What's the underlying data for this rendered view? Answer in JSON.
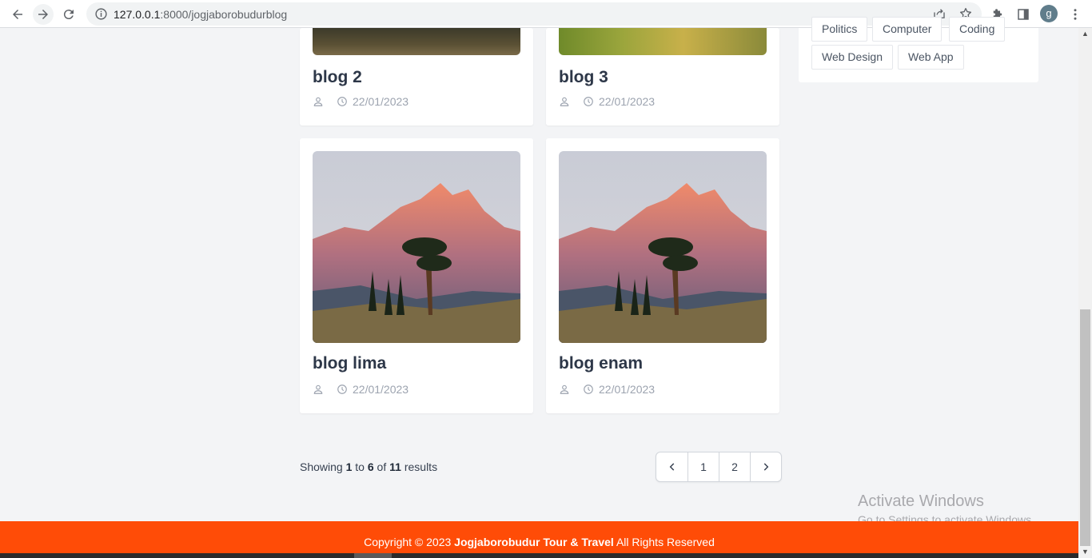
{
  "browser": {
    "url_host": "127.0.0.1",
    "url_rest": ":8000/jogjaborobudurblog",
    "profile_initial": "g"
  },
  "tags": {
    "cut_row": [
      "Politics",
      "Computer",
      "Coding"
    ],
    "row": [
      "Web Design",
      "Web App"
    ]
  },
  "posts": [
    {
      "title": "blog 2",
      "date": "22/01/2023"
    },
    {
      "title": "blog 3",
      "date": "22/01/2023"
    },
    {
      "title": "blog lima",
      "date": "22/01/2023"
    },
    {
      "title": "blog enam",
      "date": "22/01/2023"
    }
  ],
  "pagination": {
    "showing_prefix": "Showing",
    "from": "1",
    "to_word": "to",
    "to": "6",
    "of_word": "of",
    "total": "11",
    "results_word": "results",
    "pages": [
      "1",
      "2"
    ]
  },
  "watermark": {
    "line1": "Activate Windows",
    "line2": "Go to Settings to activate Windows."
  },
  "footer": {
    "prefix": "Copyright © 2023",
    "brand": "Jogjaborobudur Tour & Travel",
    "suffix": "All Rights Reserved"
  },
  "icons": {
    "back": "arrow-left-icon",
    "forward": "arrow-right-icon",
    "reload": "reload-icon",
    "info": "info-icon",
    "share": "share-icon",
    "bookmark": "star-icon",
    "extensions": "puzzle-icon",
    "sidepanel": "side-panel-icon",
    "menu": "kebab-menu-icon",
    "author": "user-icon",
    "date": "clock-icon"
  },
  "colors": {
    "footer_bg": "#ff4c07",
    "page_bg": "#f3f4f6"
  }
}
